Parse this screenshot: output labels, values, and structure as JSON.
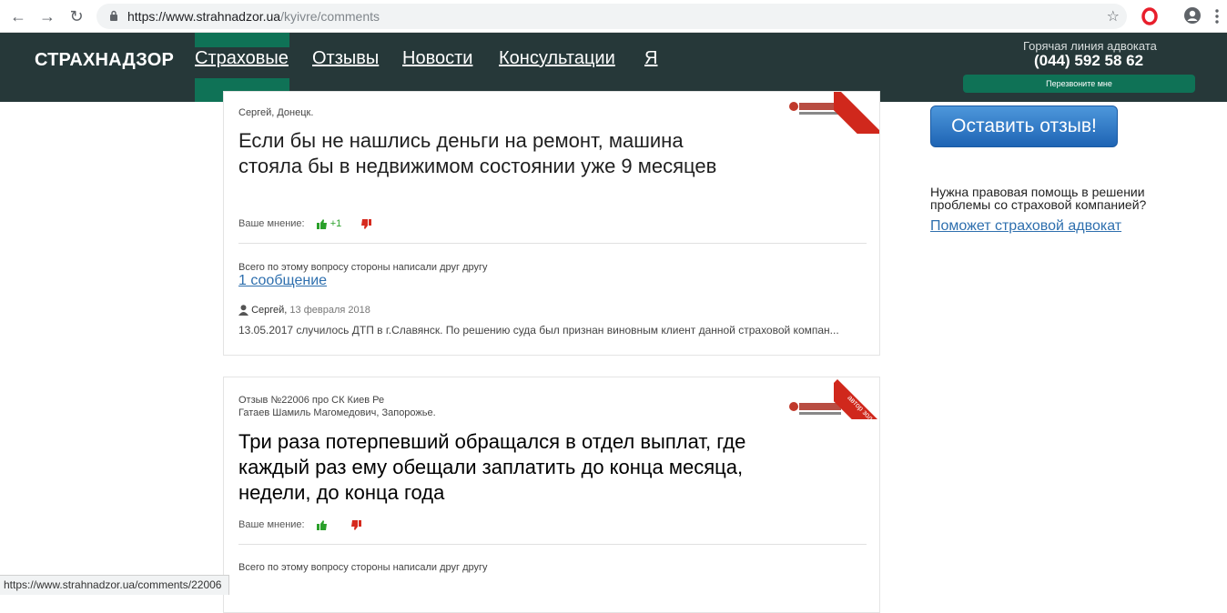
{
  "browser": {
    "url_host": "https://www.strahnadzor.ua",
    "url_path": "/kyivre/comments",
    "status_url": "https://www.strahnadzor.ua/comments/22006"
  },
  "header": {
    "logo": "СТРАХНАДЗОР",
    "menu": [
      "Страховые",
      "Отзывы",
      "Новости",
      "Консультации",
      "Я"
    ],
    "hotline_label": "Горячая линия адвоката",
    "hotline_phone": "(044) 592 58 62",
    "callback_label": "Перезвоните мне"
  },
  "sidebar": {
    "leave_review": "Оставить отзыв!",
    "help_text": "Нужна правовая помощь в решении проблемы со страховой компанией?",
    "help_link": "Поможет страховой адвокат"
  },
  "reviews": [
    {
      "author_line": "Сергей, Донецк.",
      "title": "Если бы не нашлись деньги на ремонт, машина стояла бы в недвижимом состоянии уже 9 месяцев",
      "vote_label": "Ваше мнение:",
      "likes": "+1",
      "total_label": "Всего по этому вопросу стороны написали друг другу",
      "messages_link": "1 сообщение",
      "comment_author": "Сергей,",
      "comment_date": "13 февраля 2018",
      "comment_text": "13.05.2017 случилось ДТП в г.Славянск. По решению суда был признан виновным клиент данной страховой компан..."
    },
    {
      "review_line": "Отзыв №22006 про СК Киев Ре",
      "author_line": "Гатаев Шамиль Магомедович, Запорожье.",
      "ribbon": "автор зол",
      "title": "Три раза потерпевший обращался в отдел выплат, где каждый раз ему обещали заплатить до конца месяца, недели, до конца года",
      "vote_label": "Ваше мнение:",
      "total_label": "Всего по этому вопросу стороны написали друг другу"
    }
  ],
  "colors": {
    "header_bg": "#263839",
    "accent_green": "#0f7256",
    "link_blue": "#2e6fae",
    "ribbon_red": "#d0281c"
  }
}
